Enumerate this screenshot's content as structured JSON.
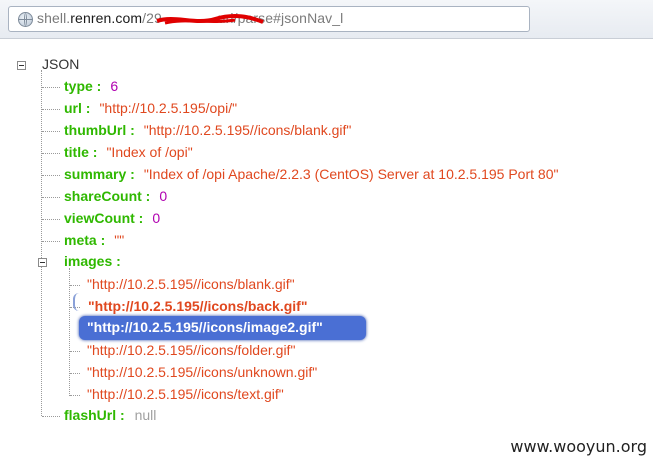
{
  "browser": {
    "url_prefix": "shell.",
    "url_host": "renren.com",
    "url_path": "/29",
    "url_suffix": "url/parse#jsonNav_l"
  },
  "tree": {
    "root_label": "JSON",
    "fields": [
      {
        "key": "type :",
        "value": "6",
        "kind": "num"
      },
      {
        "key": "url :",
        "value": "\"http://10.2.5.195/opi/\"",
        "kind": "str"
      },
      {
        "key": "thumbUrl :",
        "value": "\"http://10.2.5.195//icons/blank.gif\"",
        "kind": "str"
      },
      {
        "key": "title :",
        "value": "\"Index of /opi\"",
        "kind": "str"
      },
      {
        "key": "summary :",
        "value": "\"Index of /opi Apache/2.2.3 (CentOS) Server at 10.2.5.195 Port 80\"",
        "kind": "str"
      },
      {
        "key": "shareCount :",
        "value": "0",
        "kind": "num"
      },
      {
        "key": "viewCount :",
        "value": "0",
        "kind": "num"
      },
      {
        "key": "meta :",
        "value": "\"\"",
        "kind": "str"
      }
    ],
    "images_key": "images :",
    "images": [
      "\"http://10.2.5.195//icons/blank.gif\"",
      "\"http://10.2.5.195//icons/back.gif\"",
      "\"http://10.2.5.195//icons/image2.gif\"",
      "\"http://10.2.5.195//icons/folder.gif\"",
      "\"http://10.2.5.195//icons/unknown.gif\"",
      "\"http://10.2.5.195//icons/text.gif\""
    ],
    "flash_key": "flashUrl :",
    "flash_value": "null"
  },
  "watermark": "www.wooyun.org",
  "colors": {
    "key": "#2fb800",
    "string": "#e0481f",
    "number": "#b000b0",
    "null": "#a0a0a0",
    "selection": "#4a6fd4"
  }
}
